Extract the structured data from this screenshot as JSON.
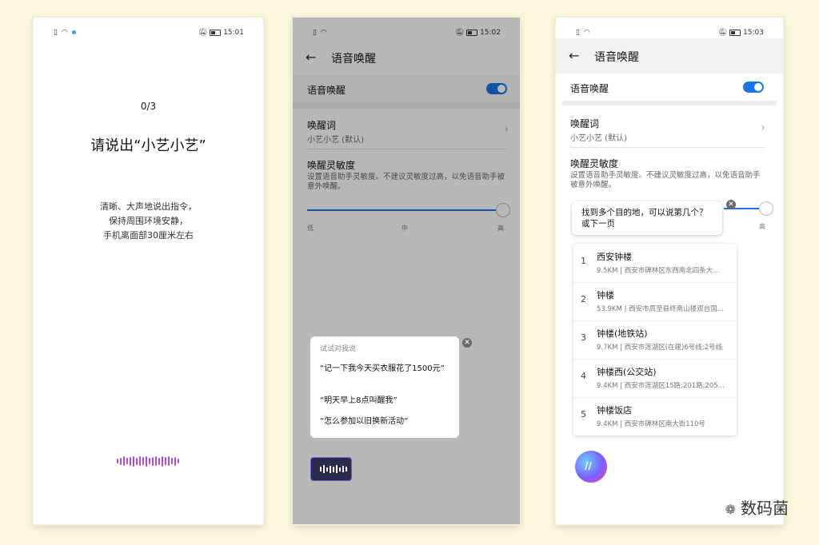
{
  "phone1": {
    "status": {
      "time": "15:01"
    },
    "counter": "0/3",
    "prompt": "请说出“小艺小艺”",
    "hint": [
      "清晰、大声地说出指令，",
      "保持周围环境安静，",
      "手机离面部30厘米左右"
    ]
  },
  "phone2": {
    "status": {
      "time": "15:02"
    },
    "header_title": "语音唤醒",
    "voice_wake_label": "语音唤醒",
    "wake_word_label": "唤醒词",
    "wake_word_value": "小艺小艺 (默认)",
    "sensitivity_label": "唤醒灵敏度",
    "sensitivity_desc": "设置语音助手灵敏度。不建议灵敏度过高，以免语音助手被意外唤醒。",
    "ticks": [
      "低",
      "中",
      "高"
    ],
    "card": {
      "heading": "试试对我说",
      "suggestions": [
        "“记一下我今天买衣服花了1500元”",
        "“明天早上8点叫醒我”",
        "“怎么参加以旧换新活动”"
      ]
    }
  },
  "phone3": {
    "status": {
      "time": "15:03"
    },
    "header_title": "语音唤醒",
    "voice_wake_label": "语音唤醒",
    "wake_word_label": "唤醒词",
    "wake_word_value": "小艺小艺 (默认)",
    "sensitivity_label": "唤醒灵敏度",
    "sensitivity_desc": "设置语音助手灵敏度。不建议灵敏度过高，以免语音助手被意外唤醒。",
    "tick_high": "高",
    "bubble_text": [
      "找到多个目的地，可以说第几个？",
      "或下一页"
    ],
    "results": [
      {
        "num": "1",
        "name": "西安钟楼",
        "addr": "9.5KM | 西安市碑林区东西南北四条大..."
      },
      {
        "num": "2",
        "name": "钟楼",
        "addr": "53.9KM | 西安市周至县终南山楼观台国..."
      },
      {
        "num": "3",
        "name": "钟楼(地铁站)",
        "addr": "9.7KM | 西安市莲湖区(在建)6号线;2号线"
      },
      {
        "num": "4",
        "name": "钟楼西(公交站)",
        "addr": "9.4KM | 西安市莲湖区15路;201路;205..."
      },
      {
        "num": "5",
        "name": "钟楼饭店",
        "addr": "9.4KM | 西安市碑林区南大街110号"
      }
    ]
  },
  "watermark": "数码菌",
  "colors": {
    "accent": "#1a73e8",
    "background": "#fbf7dc"
  }
}
